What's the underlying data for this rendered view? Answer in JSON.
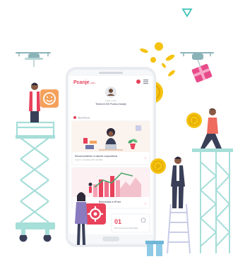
{
  "phone": {
    "brand": "Pcanje",
    "brand_suffix": ".com",
    "greeting": "Hola, Lucía",
    "points_text": "Tienes $ 200 Puntos Dcanje",
    "section_label": "Beneficios",
    "card1_title": "Reconocimiento a valores corporativos",
    "card1_sub": "1 de 14 - Inventario 2017-12-3001",
    "card2_title": "Bienvenida a ePoint",
    "counter_value": "01",
    "counter_label": "Reconocimientos disponibles"
  },
  "colors": {
    "brand_red": "#e8415a",
    "coin_gold": "#f5c20f",
    "teal": "#a6ded8",
    "ink": "#3a3f58"
  },
  "icons": [
    "drone-icon",
    "smiley-icon",
    "coin-icon",
    "gear-icon",
    "gift-icon"
  ]
}
